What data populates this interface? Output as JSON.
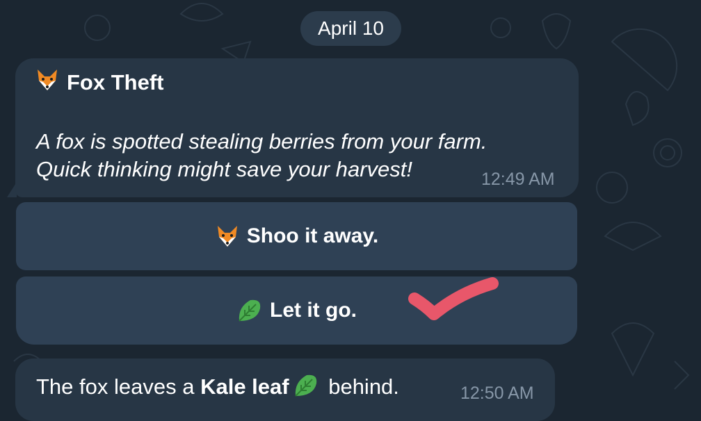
{
  "date_label": "April 10",
  "event": {
    "icon": "fox-face-icon",
    "title": "Fox Theft",
    "body_line1": "A fox is spotted stealing berries from your farm.",
    "body_line2": "Quick thinking might save your harvest!",
    "time": "12:49 AM"
  },
  "buttons": [
    {
      "icon": "fox-face-icon",
      "label": "Shoo it away."
    },
    {
      "icon": "leafy-green-icon",
      "label": "Let it go."
    }
  ],
  "result": {
    "text_before": "The fox leaves a ",
    "bold_text": "Kale leaf",
    "icon": "leafy-green-icon",
    "text_after": " behind.",
    "time": "12:50 AM"
  },
  "colors": {
    "background": "#1b2631",
    "bubble": "#273645",
    "button": "#2f4155",
    "date_pill": "#2c3c4c",
    "timestamp": "#8797a8",
    "check_mark": "#e8576a"
  }
}
